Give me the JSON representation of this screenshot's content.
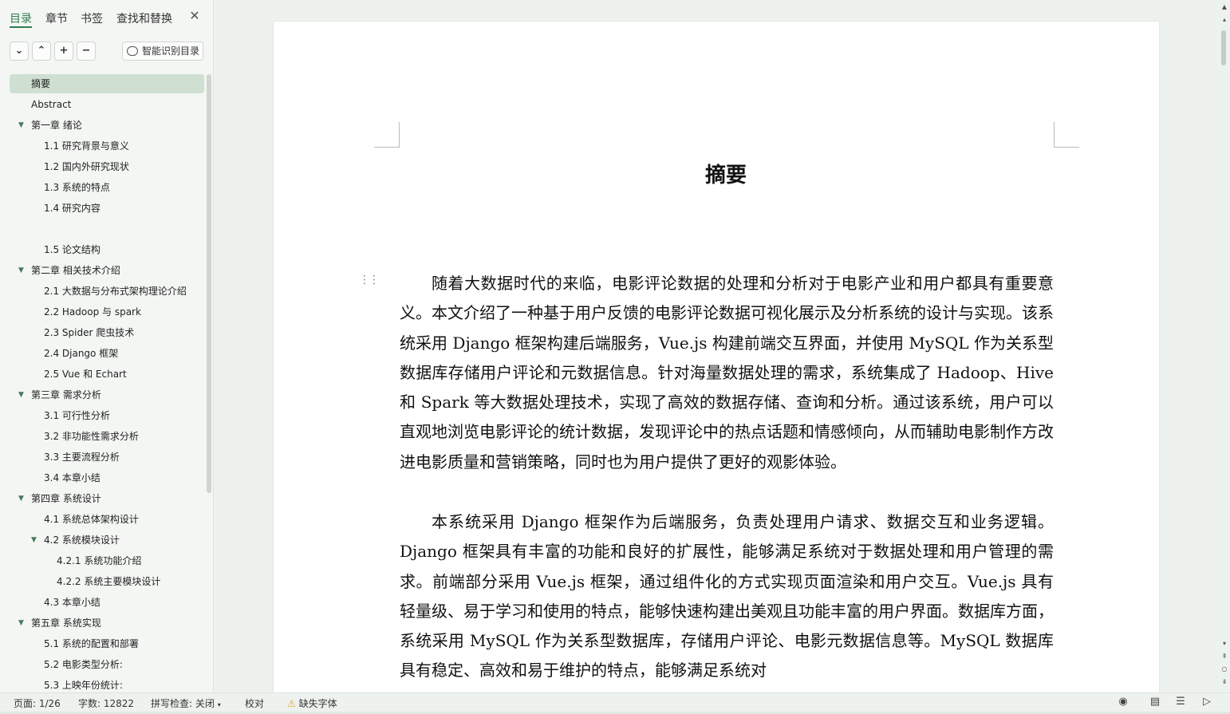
{
  "sidebar": {
    "tabs": [
      {
        "label": "目录"
      },
      {
        "label": "章节"
      },
      {
        "label": "书签"
      },
      {
        "label": "查找和替换"
      }
    ],
    "close_icon": "close-icon",
    "toolbar": {
      "collapse_icon": "chevron-down-icon",
      "expand_icon": "chevron-up-icon",
      "add_icon": "plus-icon",
      "remove_icon": "minus-icon",
      "smart_toc_label": "智能识别目录"
    },
    "toc": [
      {
        "label": "摘要",
        "level": 1,
        "selected": true
      },
      {
        "label": "Abstract",
        "level": 1
      },
      {
        "label": "第一章 绪论",
        "level": 1,
        "expanded": true
      },
      {
        "label": "1.1 研究背景与意义",
        "level": 2
      },
      {
        "label": "1.2 国内外研究现状",
        "level": 2
      },
      {
        "label": "1.3 系统的特点",
        "level": 2
      },
      {
        "label": "1.4 研究内容",
        "level": 2
      },
      {
        "label": "1.5 论文结构",
        "level": 2
      },
      {
        "label": "第二章 相关技术介绍",
        "level": 1,
        "expanded": true
      },
      {
        "label": "2.1 大数据与分布式架构理论介绍",
        "level": 2
      },
      {
        "label": "2.2 Hadoop 与 spark",
        "level": 2
      },
      {
        "label": "2.3 Spider 爬虫技术",
        "level": 2
      },
      {
        "label": "2.4 Django 框架",
        "level": 2
      },
      {
        "label": "2.5 Vue 和 Echart",
        "level": 2
      },
      {
        "label": "第三章 需求分析",
        "level": 1,
        "expanded": true
      },
      {
        "label": "3.1 可行性分析",
        "level": 2
      },
      {
        "label": "3.2 非功能性需求分析",
        "level": 2
      },
      {
        "label": "3.3 主要流程分析",
        "level": 2
      },
      {
        "label": "3.4 本章小结",
        "level": 2
      },
      {
        "label": "第四章 系统设计",
        "level": 1,
        "expanded": true
      },
      {
        "label": "4.1 系统总体架构设计",
        "level": 2
      },
      {
        "label": "4.2 系统模块设计",
        "level": 2,
        "expanded": true
      },
      {
        "label": "4.2.1 系统功能介绍",
        "level": 3
      },
      {
        "label": "4.2.2 系统主要模块设计",
        "level": 3
      },
      {
        "label": "4.3 本章小结",
        "level": 2
      },
      {
        "label": "第五章 系统实现",
        "level": 1,
        "expanded": true
      },
      {
        "label": "5.1 系统的配置和部署",
        "level": 2
      },
      {
        "label": "5.2 电影类型分析:",
        "level": 2
      },
      {
        "label": "5.3 上映年份统计:",
        "level": 2
      }
    ]
  },
  "document": {
    "title": "摘要",
    "paragraphs": [
      "随着大数据时代的来临，电影评论数据的处理和分析对于电影产业和用户都具有重要意义。本文介绍了一种基于用户反馈的电影评论数据可视化展示及分析系统的设计与实现。该系统采用 Django 框架构建后端服务，Vue.js 构建前端交互界面，并使用 MySQL 作为关系型数据库存储用户评论和元数据信息。针对海量数据处理的需求，系统集成了 Hadoop、Hive 和 Spark 等大数据处理技术，实现了高效的数据存储、查询和分析。通过该系统，用户可以直观地浏览电影评论的统计数据，发现评论中的热点话题和情感倾向，从而辅助电影制作方改进电影质量和营销策略，同时也为用户提供了更好的观影体验。",
      "本系统采用 Django 框架作为后端服务，负责处理用户请求、数据交互和业务逻辑。Django 框架具有丰富的功能和良好的扩展性，能够满足系统对于数据处理和用户管理的需求。前端部分采用 Vue.js 框架，通过组件化的方式实现页面渲染和用户交互。Vue.js 具有轻量级、易于学习和使用的特点，能够快速构建出美观且功能丰富的用户界面。数据库方面，系统采用 MySQL 作为关系型数据库，存储用户评论、电影元数据信息等。MySQL 数据库具有稳定、高效和易于维护的特点，能够满足系统对"
    ]
  },
  "statusbar": {
    "page": "页面: 1/26",
    "word_count": "字数: 12822",
    "spellcheck": "拼写检查: 关闭",
    "proofread": "校对",
    "missing_font": "缺失字体",
    "warning_icon": "warning-icon",
    "eye_icon": "eye-icon",
    "page_view_icon": "page-view-icon",
    "outline_view_icon": "outline-view-icon",
    "play_icon": "play-icon"
  },
  "colors": {
    "accent": "#2e7d4f",
    "selected_bg": "#cfe0d2",
    "sidebar_bg": "#f3f6f3",
    "warning": "#e8a317"
  }
}
